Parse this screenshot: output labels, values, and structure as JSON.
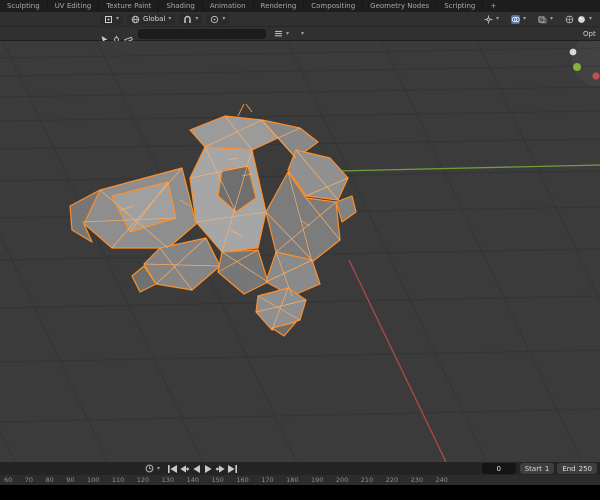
{
  "colors": {
    "selection_outline": "#ff8f2a",
    "wireframe": "#ffb066",
    "axis_x": "#b04a46",
    "axis_y": "#6f9e3a",
    "active_toggle_blue": "#4772b3"
  },
  "icons": {
    "chevron": "▾",
    "plus": "+"
  },
  "topbar": {
    "tabs": [
      "Sculpting",
      "UV Editing",
      "Texture Paint",
      "Shading",
      "Animation",
      "Rendering",
      "Compositing",
      "Geometry Nodes",
      "Scripting"
    ]
  },
  "viewport_header": {
    "orientation_label": "Global"
  },
  "tool_bar": {
    "options_label": "Options"
  },
  "timeline": {
    "current_frame": "0",
    "start_label": "Start",
    "start_value": "1",
    "end_label": "End",
    "end_value": "250",
    "ruler": [
      "60",
      "70",
      "80",
      "90",
      "100",
      "110",
      "120",
      "130",
      "140",
      "150",
      "160",
      "170",
      "180",
      "190",
      "200",
      "210",
      "220",
      "230",
      "240"
    ]
  }
}
